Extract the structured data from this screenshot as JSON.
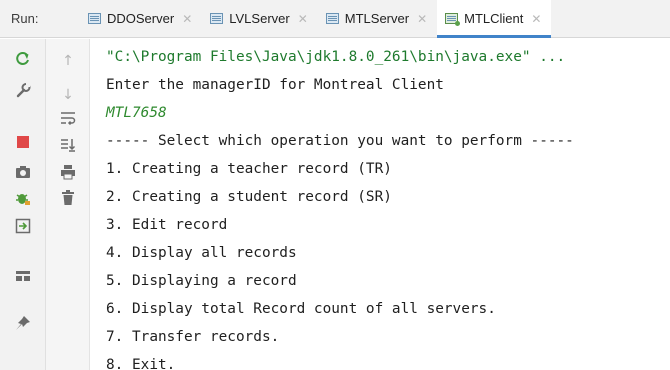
{
  "run_panel": {
    "label": "Run:",
    "tabs": [
      {
        "label": "DDOServer",
        "active": false
      },
      {
        "label": "LVLServer",
        "active": false
      },
      {
        "label": "MTLServer",
        "active": false
      },
      {
        "label": "MTLClient",
        "active": true
      }
    ]
  },
  "toolbar": {
    "left": [
      "rerun-icon",
      "wrench-icon",
      "stop-icon",
      "camera-icon",
      "debug-icon",
      "exit-icon",
      "layout-icon",
      "pin-icon"
    ],
    "right": [
      "scroll-up-icon",
      "scroll-down-icon",
      "soft-wrap-icon",
      "scroll-to-end-icon",
      "print-icon",
      "trash-icon"
    ]
  },
  "console": {
    "lines": [
      "\"C:\\Program Files\\Java\\jdk1.8.0_261\\bin\\java.exe\" ...",
      "Enter the managerID for Montreal Client",
      "MTL7658",
      "----- Select which operation you want to perform -----",
      "1. Creating a teacher record (TR)",
      "2. Creating a student record (SR)",
      "3. Edit record",
      "4. Display all records",
      "5. Displaying a record",
      "6. Display total Record count of all servers.",
      "7. Transfer records.",
      "8. Exit."
    ]
  },
  "colors": {
    "command_text": "#1e7a2d",
    "user_input_text": "#2f8a2f",
    "active_tab_underline": "#4083c9",
    "stop_red": "#e04848"
  }
}
